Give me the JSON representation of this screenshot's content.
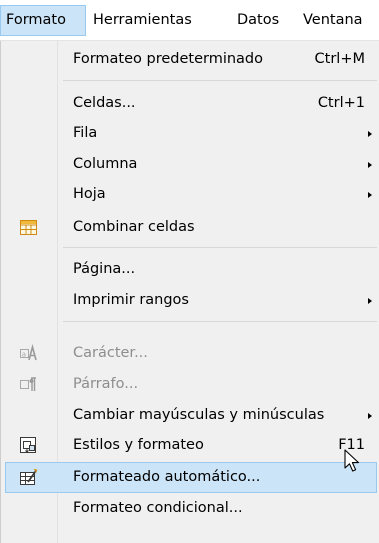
{
  "menubar": {
    "items": [
      {
        "label": "Formato"
      },
      {
        "label": "Herramientas"
      },
      {
        "label": "Datos"
      },
      {
        "label": "Ventana"
      }
    ]
  },
  "menu": {
    "items": [
      {
        "label": "Formateo predeterminado",
        "shortcut": "Ctrl+M"
      },
      {
        "label": "Celdas...",
        "shortcut": "Ctrl+1"
      },
      {
        "label": "Fila"
      },
      {
        "label": "Columna"
      },
      {
        "label": "Hoja"
      },
      {
        "label": "Combinar celdas",
        "icon": "merge-cells-icon"
      },
      {
        "label": "Página..."
      },
      {
        "label": "Imprimir rangos"
      },
      {
        "label": "Carácter...",
        "icon": "character-icon",
        "disabled": true
      },
      {
        "label": "Párrafo...",
        "icon": "paragraph-icon",
        "disabled": true
      },
      {
        "label": "Cambiar mayúsculas y minúsculas"
      },
      {
        "label": "Estilos y formateo",
        "shortcut": "F11",
        "icon": "styles-icon"
      },
      {
        "label": "Formateado automático...",
        "icon": "autoformat-icon",
        "highlighted": true
      },
      {
        "label": "Formateo condicional..."
      }
    ]
  },
  "colors": {
    "menu_background": "#f0f0f0",
    "highlight_background": "#cce4f7",
    "highlight_border": "#99c9ef",
    "disabled_text": "#8e8e8e"
  }
}
